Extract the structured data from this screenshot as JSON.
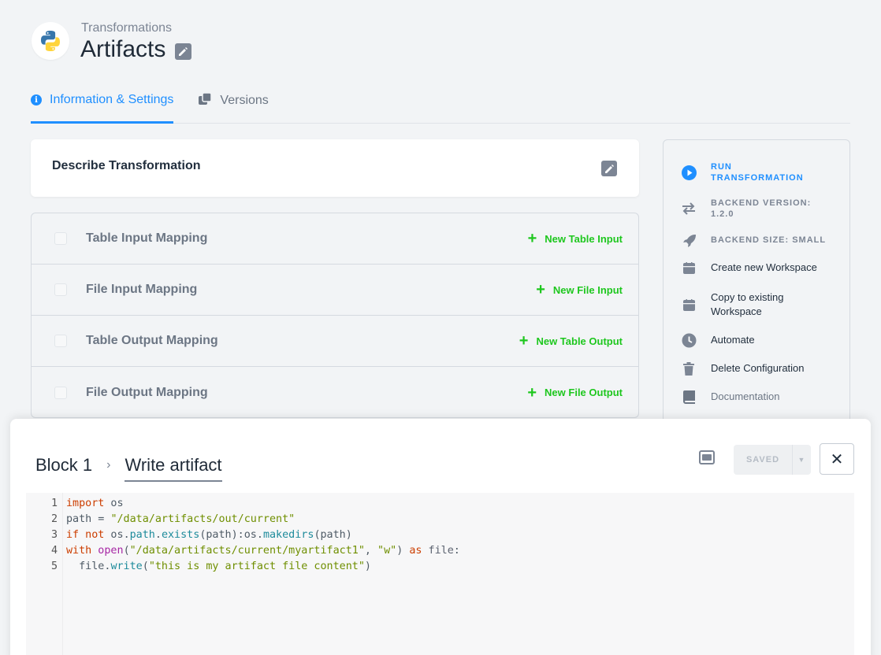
{
  "header": {
    "breadcrumb": "Transformations",
    "title": "Artifacts",
    "logo": "python-logo"
  },
  "tabs": [
    {
      "label": "Information & Settings",
      "icon": "info-icon",
      "active": true
    },
    {
      "label": "Versions",
      "icon": "versions-icon",
      "active": false
    }
  ],
  "describe": {
    "label": "Describe Transformation"
  },
  "mappings": [
    {
      "label": "Table Input Mapping",
      "action": "New Table Input"
    },
    {
      "label": "File Input Mapping",
      "action": "New File Input"
    },
    {
      "label": "Table Output Mapping",
      "action": "New Table Output"
    },
    {
      "label": "File Output Mapping",
      "action": "New File Output"
    }
  ],
  "sidebar": {
    "run_line1": "RUN",
    "run_line2": "TRANSFORMATION",
    "backend_version_line1": "BACKEND VERSION:",
    "backend_version_line2": "1.2.0",
    "backend_size": "BACKEND SIZE: SMALL",
    "create_workspace": "Create new Workspace",
    "copy_workspace_line1": "Copy to existing",
    "copy_workspace_line2": "Workspace",
    "automate": "Automate",
    "delete": "Delete Configuration",
    "documentation": "Documentation"
  },
  "panel": {
    "block": "Block 1",
    "code_name": "Write artifact",
    "saved_label": "SAVED",
    "close_symbol": "✕",
    "line_numbers": [
      "1",
      "2",
      "3",
      "4",
      "5"
    ],
    "code": {
      "l1_kw": "import",
      "l1_rest": " os",
      "l2_var": "path",
      "l2_eq": " = ",
      "l2_str": "\"/data/artifacts/out/current\"",
      "l3_kw": "if not",
      "l3_os": " os",
      "l3_dot1": ".",
      "l3_path": "path",
      "l3_dot2": ".",
      "l3_exists": "exists",
      "l3_args": "(path):",
      "l3_os2": "os",
      "l3_dot3": ".",
      "l3_makedirs": "makedirs",
      "l3_args2": "(path)",
      "l4_with": "with",
      "l4_open": " open",
      "l4_p1": "(",
      "l4_str1": "\"/data/artifacts/current/myartifact1\"",
      "l4_comma": ", ",
      "l4_str2": "\"w\"",
      "l4_p2": ") ",
      "l4_as": "as",
      "l4_file": " file",
      "l4_colon": ":",
      "l5_indent": "  ",
      "l5_file": "file",
      "l5_dot": ".",
      "l5_write": "write",
      "l5_p1": "(",
      "l5_str": "\"this is my artifact file content\"",
      "l5_p2": ")"
    }
  },
  "colors": {
    "accent": "#1f8fff",
    "green_action": "#1ec71e",
    "muted": "#7c8594"
  }
}
